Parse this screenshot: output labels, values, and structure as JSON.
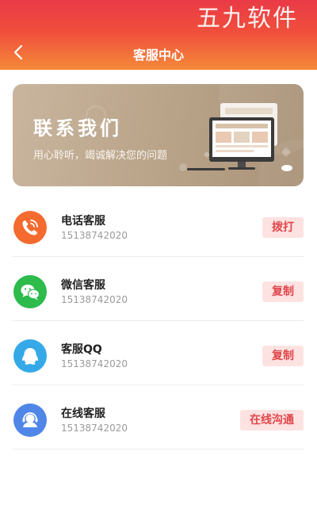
{
  "watermark": "五九软件",
  "header": {
    "title": "客服中心",
    "back_icon": "chevron-left-icon"
  },
  "banner": {
    "title": "联系我们",
    "subtitle": "用心聆听，竭诚解决您的问题"
  },
  "contacts": [
    {
      "name": "电话客服",
      "number": "15138742020",
      "action": "拨打",
      "icon": "phone-icon",
      "color": "#f46a2f"
    },
    {
      "name": "微信客服",
      "number": "15138742020",
      "action": "复制",
      "icon": "wechat-icon",
      "color": "#2dbb4c"
    },
    {
      "name": "客服QQ",
      "number": "15138742020",
      "action": "复制",
      "icon": "qq-icon",
      "color": "#35a9e8"
    },
    {
      "name": "在线客服",
      "number": "15138742020",
      "action": "在线沟通",
      "icon": "headset-icon",
      "color": "#4f86e8"
    }
  ],
  "colors": {
    "header_top": "#ea3a47",
    "header_bottom": "#f5893a",
    "action_bg": "#fde2e2",
    "action_text": "#e2454a"
  }
}
